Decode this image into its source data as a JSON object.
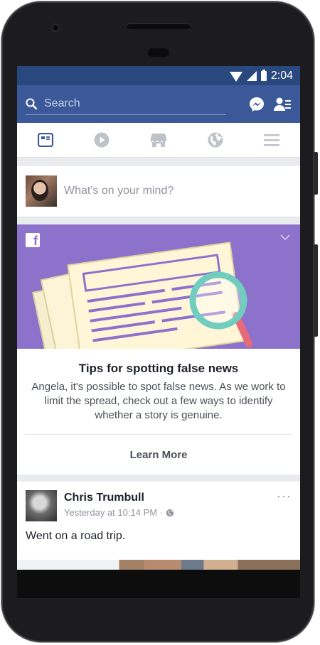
{
  "status_bar": {
    "time": "2:04"
  },
  "nav": {
    "search_placeholder": "Search",
    "icons": [
      "messenger-icon",
      "friend-requests-icon"
    ]
  },
  "tabs": [
    {
      "name": "news-feed",
      "icon": "news-feed-icon",
      "active": true
    },
    {
      "name": "watch",
      "icon": "play-icon",
      "active": false
    },
    {
      "name": "marketplace",
      "icon": "store-icon",
      "active": false
    },
    {
      "name": "notifications",
      "icon": "globe-icon",
      "active": false
    },
    {
      "name": "menu",
      "icon": "hamburger-menu-icon",
      "active": false
    }
  ],
  "composer": {
    "prompt": "What's on your mind?"
  },
  "tip_card": {
    "title": "Tips for spotting false news",
    "description": "Angela, it's possible to spot false news. As we work to limit the spread, check out a few ways to identify whether a story is genuine.",
    "cta": "Learn More",
    "hero_color": "#8c72cb",
    "logo_letter": "f"
  },
  "post": {
    "author": "Chris Trumbull",
    "time": "Yesterday at 10:14 PM",
    "separator": "·",
    "text": "Went on a road trip.",
    "more": "···"
  },
  "colors": {
    "brand": "#3b5998",
    "status": "#29487d",
    "accent_purple": "#8c72cb"
  }
}
